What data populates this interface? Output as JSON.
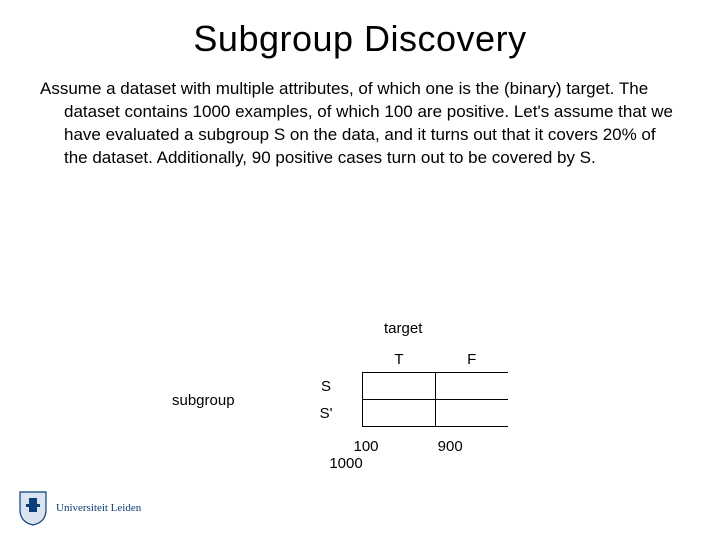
{
  "title": "Subgroup Discovery",
  "body": "Assume a dataset with multiple attributes, of which one is the (binary) target. The dataset contains 1000 examples, of which 100 are positive. Let's assume that we have evaluated a subgroup S on the data, and it turns out that it covers 20% of the dataset. Additionally, 90 positive cases turn out to be covered by S.",
  "table": {
    "col_header": "target",
    "row_header": "subgroup",
    "cols": {
      "t": "T",
      "f": "F"
    },
    "rows": {
      "s": "S",
      "sc": "S'"
    },
    "totals": {
      "t": "100",
      "f": "900",
      "n": "1000"
    }
  },
  "footer": {
    "affiliation": "Universiteit Leiden"
  }
}
